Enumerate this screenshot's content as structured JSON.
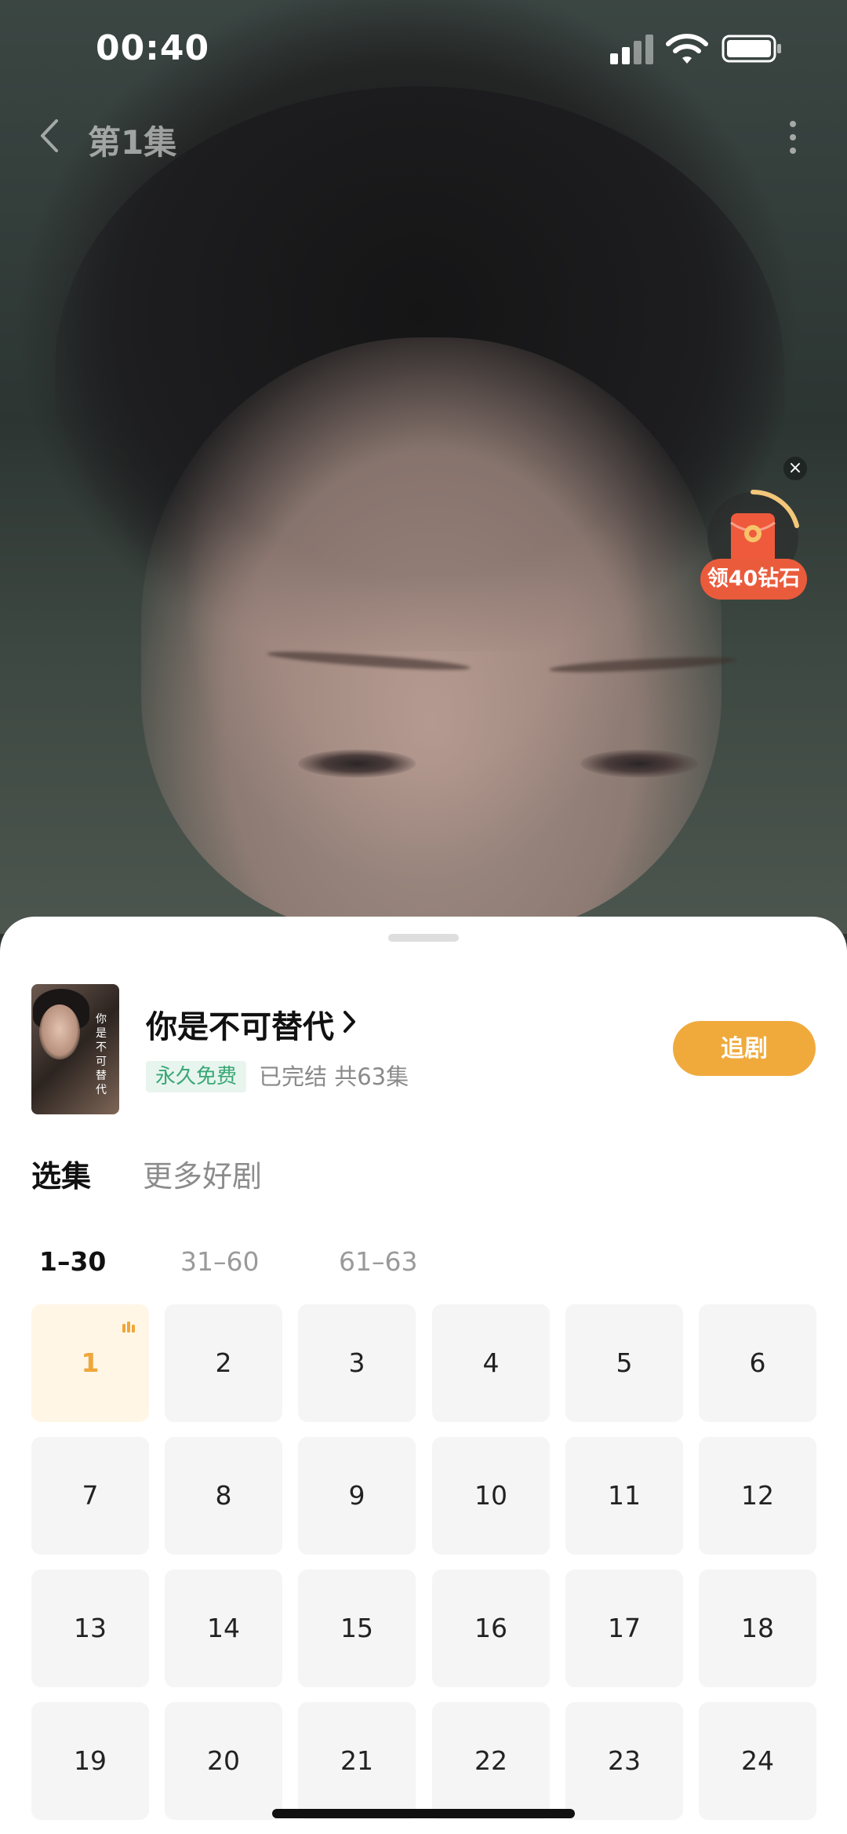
{
  "status_bar": {
    "time": "00:40"
  },
  "nav": {
    "title": "第1集"
  },
  "reward": {
    "label": "领40钻石",
    "close": "×"
  },
  "drama": {
    "title": "你是不可替代",
    "poster_text": "你是不可替代",
    "free_tag": "永久免费",
    "meta": "已完结 共63集",
    "follow_label": "追剧"
  },
  "tabs": [
    "选集",
    "更多好剧"
  ],
  "ranges": [
    "1–30",
    "31–60",
    "61–63"
  ],
  "episodes": [
    "1",
    "2",
    "3",
    "4",
    "5",
    "6",
    "7",
    "8",
    "9",
    "10",
    "11",
    "12",
    "13",
    "14",
    "15",
    "16",
    "17",
    "18",
    "19",
    "20",
    "21",
    "22",
    "23",
    "24"
  ],
  "current_episode": "1",
  "colors": {
    "accent": "#f0aa3c",
    "free_tag_text": "#3aa776",
    "reward_badge": "#ea5b3c"
  }
}
